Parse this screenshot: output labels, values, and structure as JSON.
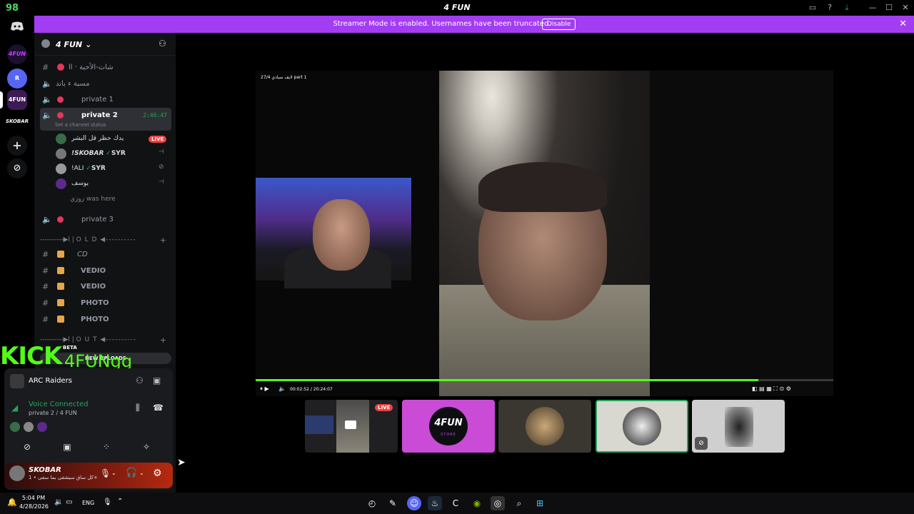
{
  "window": {
    "title": "4 FUN",
    "fps": "98"
  },
  "banner": {
    "message": "Streamer Mode is enabled. Usernames have been truncated.",
    "disable_label": "Disable"
  },
  "server": {
    "name": "4 FUN"
  },
  "guilds": [
    {
      "label": "4FUN"
    },
    {
      "label": "R"
    },
    {
      "label": "4FUN"
    },
    {
      "label": "SKOBAR"
    }
  ],
  "channels": {
    "top": [
      {
        "label": "شات-الأحبة · اا"
      },
      {
        "label": "مسبة ء باند"
      },
      {
        "label": "private 1"
      },
      {
        "label": "private 2",
        "duration": "2:46:47",
        "status_hint": "Set a channel status"
      }
    ],
    "members": [
      {
        "name": "يدك حظر قل البشر",
        "live": "LIVE"
      },
      {
        "name": "!SKOBAR",
        "tag": "SYR"
      },
      {
        "name": "!ALI",
        "tag": "SYR"
      },
      {
        "name": "يوسف"
      },
      {
        "name": "زوزي was here"
      }
    ],
    "private3": "private 3",
    "old_category": "----------▶ا | O L D ◀----------",
    "old_channels": [
      "CD",
      "VEDIO",
      "VEDIO",
      "PHOTO",
      "PHOTO"
    ],
    "out_category": "----------▶ا | O U T ◀----------",
    "new_channel": "NEW UPLOADS"
  },
  "kick": {
    "logo": "KICK",
    "beta": "BETA",
    "username": "4FUNgg"
  },
  "activity": {
    "name": "ARC Raiders"
  },
  "voice": {
    "status": "Voice Connected",
    "channel": "private 2 / 4 FUN"
  },
  "user": {
    "name": "SKOBAR",
    "status": "كل ساق سيشقى بما سقى • 1+"
  },
  "video": {
    "caption": "27/4 لايف سيادي part 1",
    "time": "00:02:52 / 20:24:07",
    "progress": 0.87
  },
  "thumbnails": [
    {
      "badge": "LIVE"
    },
    {
      "label": "4FUN",
      "sub": "STORE"
    },
    {
      "label": ""
    },
    {
      "label": ""
    },
    {
      "label": ""
    }
  ],
  "taskbar": {
    "time": "5:04 PM",
    "date": "4/28/2026",
    "lang": "ENG"
  },
  "colors": {
    "accent": "#a33df2",
    "kick_green": "#53fc18",
    "live_red": "#ed4245",
    "voice_green": "#23a55a"
  },
  "icons": [
    "discord-icon",
    "compass-icon",
    "plus-icon",
    "microphone-icon",
    "headphones-icon",
    "gear-icon",
    "windows-icon",
    "search-icon",
    "chrome-icon"
  ]
}
